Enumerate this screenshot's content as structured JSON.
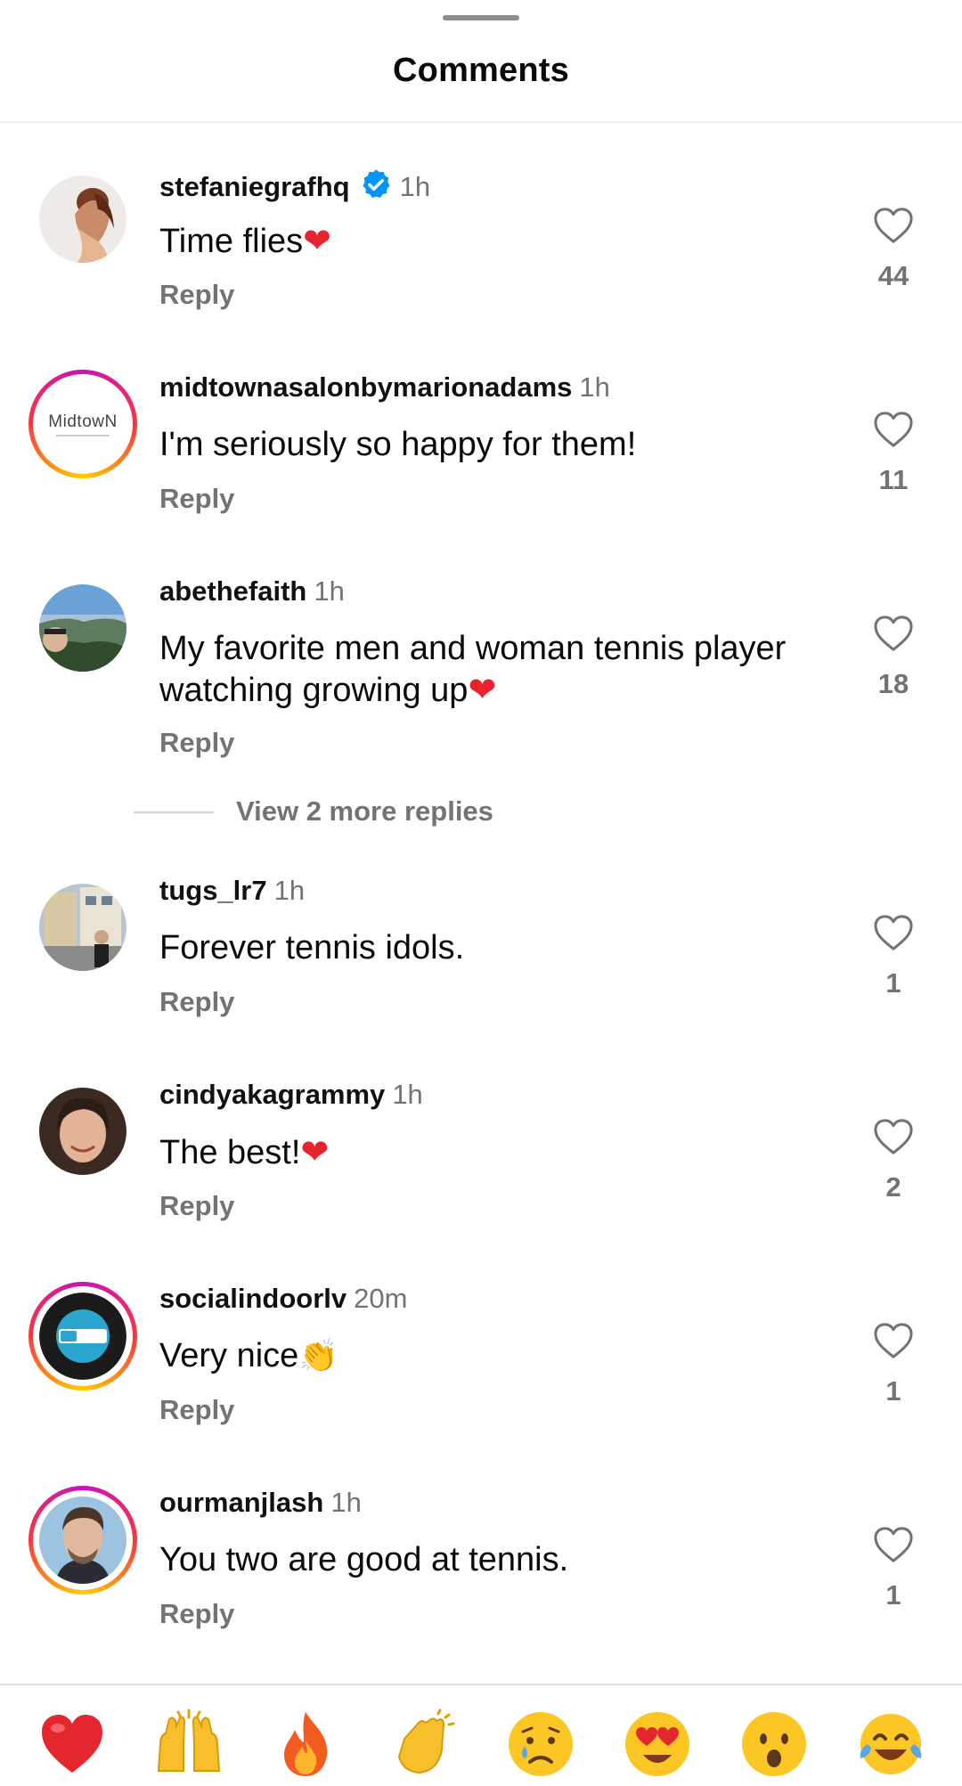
{
  "header": {
    "title": "Comments"
  },
  "comments": [
    {
      "username": "stefaniegrafhq",
      "verified": true,
      "time": "1h",
      "text": "Time flies",
      "emoji": "heart",
      "reply": "Reply",
      "likes": "44"
    },
    {
      "username": "midtownasalonbymarionadams",
      "verified": false,
      "time": "1h",
      "text": "I'm seriously so happy for them!",
      "emoji": "",
      "reply": "Reply",
      "likes": "11",
      "avatar_text": "MidtowN"
    },
    {
      "username": "abethefaith",
      "verified": false,
      "time": "1h",
      "text_line1": "My favorite men and woman tennis player",
      "text_line2": "watching growing up",
      "emoji": "heart",
      "reply": "Reply",
      "likes": "18"
    },
    {
      "username": "tugs_lr7",
      "verified": false,
      "time": "1h",
      "text": "Forever tennis idols.",
      "emoji": "",
      "reply": "Reply",
      "likes": "1"
    },
    {
      "username": "cindyakagrammy",
      "verified": false,
      "time": "1h",
      "text": "The best!",
      "emoji": "heart",
      "reply": "Reply",
      "likes": "2"
    },
    {
      "username": "socialindoorlv",
      "verified": false,
      "time": "20m",
      "text": "Very nice",
      "emoji": "clap",
      "reply": "Reply",
      "likes": "1"
    },
    {
      "username": "ourmanjlash",
      "verified": false,
      "time": "1h",
      "text": "You two are good at tennis.",
      "emoji": "",
      "reply": "Reply",
      "likes": "1"
    }
  ],
  "view_more": "View 2 more replies",
  "quick_reactions": [
    "red-heart",
    "raising-hands",
    "fire",
    "clapping-hands",
    "crying-face",
    "heart-eyes-face",
    "surprised-face",
    "tears-of-joy-face"
  ],
  "colors": {
    "secondary_text": "#737373",
    "verified_blue": "#0095f6",
    "heart_red": "#e8232e"
  }
}
